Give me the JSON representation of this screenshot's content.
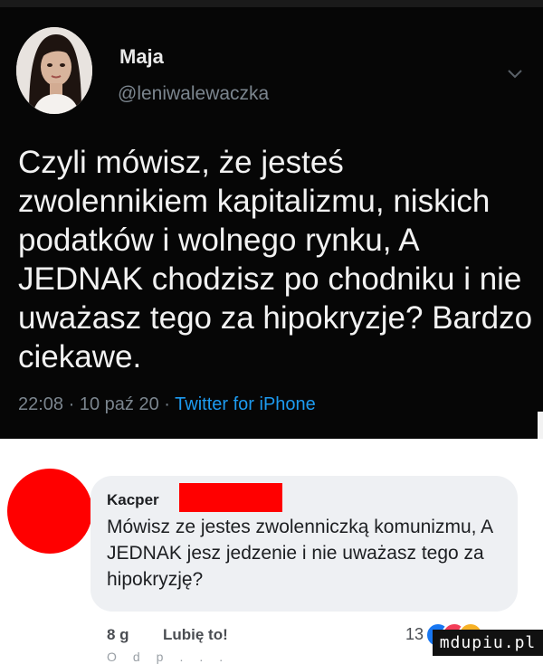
{
  "tweet": {
    "author_name": "Maja",
    "handle": "@leniwalewaczka",
    "text": "Czyli mówisz, że jesteś zwolennikiem kapitalizmu, niskich podatków i wolnego rynku, A JEDNAK chodzisz po chodniku i nie uważasz tego za hipokryzje? Bardzo ciekawe.",
    "time": "22:08",
    "date": "10 paź 20",
    "source": "Twitter for iPhone",
    "separator": "·"
  },
  "comment": {
    "author": "Kacper",
    "text": "Mówisz ze jestes zwolenniczką komunizmu, A JEDNAK jesz jedzenie i nie uważasz tego za hipokryzję?",
    "age": "8 g",
    "like_label": "Lubię to!",
    "reaction_count": "13",
    "cut_text": "Odp..."
  },
  "watermark": "mdupiu.pl",
  "colors": {
    "tweet_bg": "#060606",
    "link_blue": "#1d9bf0",
    "redaction": "#ff0000",
    "bubble": "#eef0f3"
  },
  "icons": [
    "chevron-down-icon",
    "like-reaction-icon",
    "love-reaction-icon",
    "haha-reaction-icon"
  ]
}
